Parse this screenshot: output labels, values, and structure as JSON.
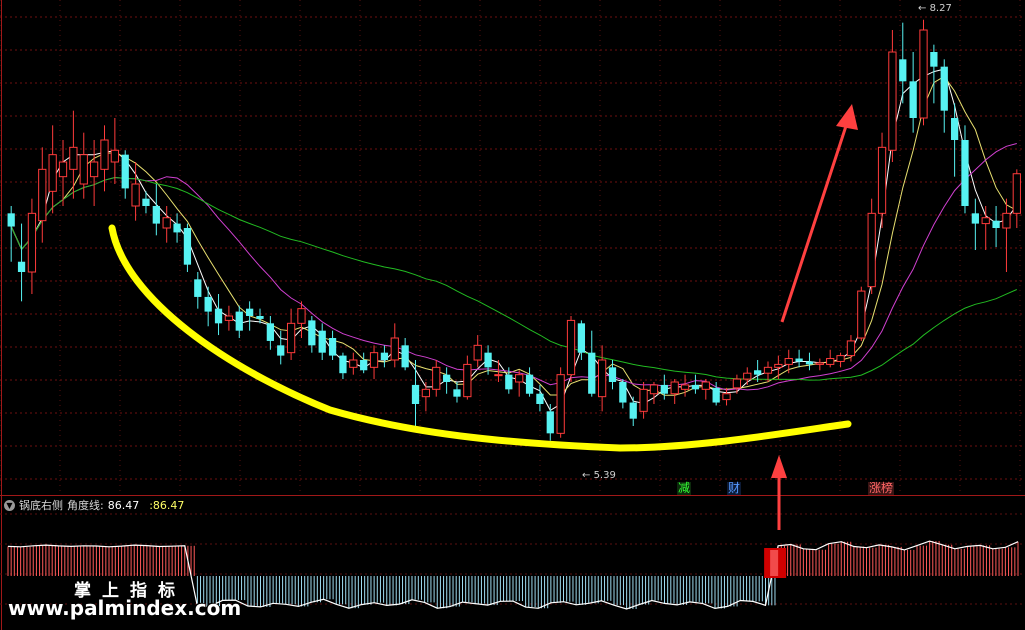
{
  "chart_data": {
    "type": "candlestick",
    "price_max_label": "8.27",
    "price_min_label": "5.39",
    "ylim": [
      5.2,
      8.35
    ],
    "candles": [
      [
        6.95,
        7.0,
        6.62,
        6.86
      ],
      [
        6.62,
        6.88,
        6.35,
        6.55
      ],
      [
        6.55,
        7.05,
        6.4,
        6.95
      ],
      [
        6.9,
        7.4,
        6.75,
        7.25
      ],
      [
        7.1,
        7.55,
        6.95,
        7.35
      ],
      [
        7.2,
        7.45,
        7.0,
        7.3
      ],
      [
        7.25,
        7.65,
        7.05,
        7.4
      ],
      [
        7.15,
        7.5,
        7.05,
        7.35
      ],
      [
        7.2,
        7.45,
        7.0,
        7.3
      ],
      [
        7.25,
        7.55,
        7.1,
        7.45
      ],
      [
        7.3,
        7.6,
        7.15,
        7.38
      ],
      [
        7.35,
        7.38,
        7.05,
        7.12
      ],
      [
        7.0,
        7.3,
        6.9,
        7.15
      ],
      [
        7.05,
        7.1,
        6.95,
        7.0
      ],
      [
        7.0,
        7.15,
        6.8,
        6.88
      ],
      [
        6.85,
        7.0,
        6.75,
        6.92
      ],
      [
        6.88,
        6.95,
        6.75,
        6.82
      ],
      [
        6.85,
        6.88,
        6.55,
        6.6
      ],
      [
        6.5,
        6.55,
        6.3,
        6.38
      ],
      [
        6.38,
        6.45,
        6.18,
        6.28
      ],
      [
        6.3,
        6.4,
        6.12,
        6.2
      ],
      [
        6.22,
        6.32,
        6.15,
        6.25
      ],
      [
        6.28,
        6.32,
        6.1,
        6.15
      ],
      [
        6.3,
        6.35,
        6.15,
        6.25
      ],
      [
        6.25,
        6.3,
        6.2,
        6.23
      ],
      [
        6.2,
        6.25,
        6.02,
        6.08
      ],
      [
        6.05,
        6.15,
        5.92,
        5.98
      ],
      [
        6.0,
        6.3,
        5.95,
        6.2
      ],
      [
        6.2,
        6.35,
        6.1,
        6.3
      ],
      [
        6.22,
        6.25,
        6.0,
        6.05
      ],
      [
        6.15,
        6.2,
        5.95,
        6.0
      ],
      [
        6.1,
        6.15,
        5.95,
        5.98
      ],
      [
        5.98,
        6.0,
        5.82,
        5.86
      ],
      [
        5.9,
        6.0,
        5.85,
        5.95
      ],
      [
        5.95,
        6.0,
        5.86,
        5.88
      ],
      [
        5.9,
        6.05,
        5.82,
        6.0
      ],
      [
        6.0,
        6.05,
        5.9,
        5.95
      ],
      [
        5.95,
        6.2,
        5.9,
        6.1
      ],
      [
        6.05,
        6.1,
        5.88,
        5.9
      ],
      [
        5.78,
        5.95,
        5.5,
        5.65
      ],
      [
        5.7,
        5.8,
        5.6,
        5.75
      ],
      [
        5.75,
        5.95,
        5.7,
        5.9
      ],
      [
        5.85,
        5.9,
        5.72,
        5.8
      ],
      [
        5.75,
        5.8,
        5.66,
        5.7
      ],
      [
        5.7,
        5.98,
        5.68,
        5.92
      ],
      [
        5.95,
        6.12,
        5.9,
        6.05
      ],
      [
        6.0,
        6.05,
        5.85,
        5.9
      ],
      [
        5.85,
        5.95,
        5.8,
        5.85
      ],
      [
        5.85,
        5.9,
        5.72,
        5.75
      ],
      [
        5.8,
        5.88,
        5.7,
        5.85
      ],
      [
        5.85,
        5.9,
        5.7,
        5.72
      ],
      [
        5.72,
        5.78,
        5.6,
        5.65
      ],
      [
        5.6,
        5.65,
        5.4,
        5.45
      ],
      [
        5.45,
        5.9,
        5.42,
        5.85
      ],
      [
        5.85,
        6.25,
        5.8,
        6.22
      ],
      [
        6.2,
        6.22,
        5.95,
        6.0
      ],
      [
        6.0,
        6.15,
        5.7,
        5.72
      ],
      [
        5.7,
        6.05,
        5.6,
        5.95
      ],
      [
        5.9,
        5.95,
        5.75,
        5.8
      ],
      [
        5.8,
        5.82,
        5.62,
        5.66
      ],
      [
        5.66,
        5.7,
        5.5,
        5.55
      ],
      [
        5.6,
        5.8,
        5.55,
        5.75
      ],
      [
        5.72,
        5.8,
        5.65,
        5.78
      ],
      [
        5.78,
        5.85,
        5.68,
        5.72
      ],
      [
        5.72,
        5.82,
        5.65,
        5.8
      ],
      [
        5.75,
        5.85,
        5.7,
        5.78
      ],
      [
        5.78,
        5.85,
        5.72,
        5.75
      ],
      [
        5.75,
        5.82,
        5.68,
        5.8
      ],
      [
        5.76,
        5.8,
        5.64,
        5.66
      ],
      [
        5.68,
        5.76,
        5.64,
        5.72
      ],
      [
        5.76,
        5.85,
        5.72,
        5.82
      ],
      [
        5.82,
        5.9,
        5.78,
        5.86
      ],
      [
        5.88,
        5.95,
        5.8,
        5.85
      ],
      [
        5.86,
        5.94,
        5.8,
        5.9
      ],
      [
        5.9,
        5.98,
        5.82,
        5.92
      ],
      [
        5.92,
        6.02,
        5.86,
        5.96
      ],
      [
        5.96,
        6.02,
        5.9,
        5.94
      ],
      [
        5.94,
        6.0,
        5.88,
        5.92
      ],
      [
        5.92,
        5.96,
        5.88,
        5.93
      ],
      [
        5.92,
        6.02,
        5.9,
        5.96
      ],
      [
        5.94,
        6.0,
        5.9,
        5.98
      ],
      [
        5.98,
        6.12,
        5.94,
        6.08
      ],
      [
        6.1,
        6.45,
        6.08,
        6.42
      ],
      [
        6.45,
        7.05,
        6.4,
        6.95
      ],
      [
        6.95,
        7.5,
        6.85,
        7.4
      ],
      [
        7.38,
        8.2,
        7.3,
        8.05
      ],
      [
        8.0,
        8.25,
        7.7,
        7.85
      ],
      [
        7.85,
        8.05,
        7.5,
        7.6
      ],
      [
        7.6,
        8.27,
        7.55,
        8.2
      ],
      [
        8.05,
        8.1,
        7.7,
        7.95
      ],
      [
        7.95,
        8.0,
        7.5,
        7.65
      ],
      [
        7.6,
        7.7,
        7.2,
        7.45
      ],
      [
        7.45,
        7.55,
        6.95,
        7.0
      ],
      [
        6.95,
        7.05,
        6.7,
        6.88
      ],
      [
        6.88,
        7.0,
        6.7,
        6.92
      ],
      [
        6.9,
        7.0,
        6.72,
        6.85
      ],
      [
        6.85,
        7.05,
        6.55,
        6.95
      ],
      [
        6.95,
        7.25,
        6.85,
        7.22
      ]
    ],
    "up_color": "#ff3b3b",
    "down_color": "#57f2f2",
    "highlight_line_color": "#ffff00",
    "arrow_color": "#ff4040",
    "indicator": {
      "name": "锅底右侧",
      "series_label": "角度线:",
      "value": "86.47",
      "value2": ":86.47",
      "values": [
        1,
        1,
        1,
        1,
        1,
        1,
        1,
        1,
        1,
        1,
        1,
        1,
        1,
        1,
        1,
        -1,
        -1,
        -1,
        -1,
        -1,
        -1,
        -1,
        -1,
        -1,
        -1,
        -1,
        -1,
        -1,
        -1,
        -1,
        -1,
        -1,
        -1,
        -1,
        -1,
        -1,
        -1,
        -1,
        -1,
        -1,
        -1,
        -1,
        -1,
        -1,
        -1,
        -1,
        -1,
        -1,
        -1,
        -1,
        -1,
        -1,
        -1,
        -1,
        -1,
        -1,
        -1,
        -1,
        -1,
        -1,
        -1,
        1,
        1,
        1,
        1,
        1,
        1,
        1,
        1,
        1,
        1,
        1,
        1,
        1,
        1,
        1,
        1,
        1,
        1,
        1,
        1
      ],
      "pos_color": "#ff5a5a",
      "neg_color": "#9fdcf0",
      "signal_color": "#d00000"
    },
    "event_tags": [
      {
        "label": "减",
        "color": "#33ff33"
      },
      {
        "label": "财",
        "color": "#5599ff"
      },
      {
        "label": "涨榜",
        "color": "#ff6666"
      }
    ]
  },
  "watermark": {
    "title": "掌上指标",
    "url": "www.palmindex.com"
  }
}
